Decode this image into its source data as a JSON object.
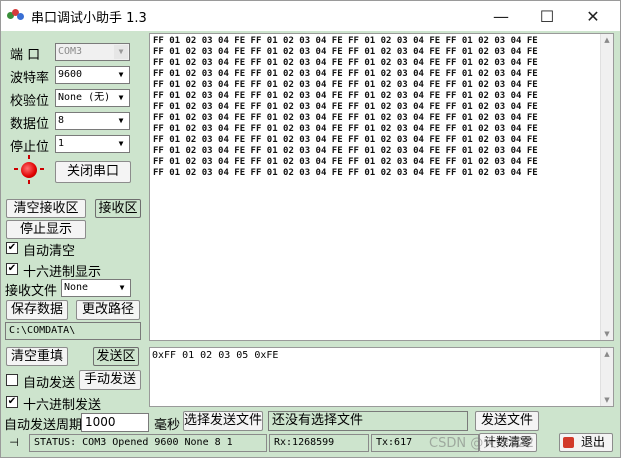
{
  "window": {
    "title": "串口调试小助手 1.3",
    "controls": {
      "minimize": "—",
      "maximize": "☐",
      "close": "✕"
    }
  },
  "port_settings": {
    "port_label": "端 口",
    "port_value": "COM3",
    "baud_label": "波特率",
    "baud_value": "9600",
    "parity_label": "校验位",
    "parity_value": "None (无)",
    "databits_label": "数据位",
    "databits_value": "8",
    "stopbits_label": "停止位",
    "stopbits_value": "1",
    "close_port_button": "关闭串口",
    "indicator_color": "#e00000"
  },
  "receive_panel": {
    "clear_button": "清空接收区",
    "area_label": "接收区",
    "stop_display_button": "停止显示",
    "auto_clear_label": "自动清空",
    "auto_clear_checked": true,
    "hex_display_label": "十六进制显示",
    "hex_display_checked": true,
    "recv_file_label": "接收文件",
    "recv_file_value": "None",
    "save_data_button": "保存数据",
    "change_path_button": "更改路径",
    "path_value": "C:\\COMDATA\\"
  },
  "receive_area": {
    "lines": [
      "FF 01 02 03 04 FE FF 01 02 03 04 FE FF 01 02 03 04 FE FF 01 02 03 04 FE",
      "FF 01 02 03 04 FE FF 01 02 03 04 FE FF 01 02 03 04 FE FF 01 02 03 04 FE",
      "FF 01 02 03 04 FE FF 01 02 03 04 FE FF 01 02 03 04 FE FF 01 02 03 04 FE",
      "FF 01 02 03 04 FE FF 01 02 03 04 FE FF 01 02 03 04 FE FF 01 02 03 04 FE",
      "FF 01 02 03 04 FE FF 01 02 03 04 FE FF 01 02 03 04 FE FF 01 02 03 04 FE",
      "FF 01 02 03 04 FE FF 01 02 03 04 FE FF 01 02 03 04 FE FF 01 02 03 04 FE",
      "FF 01 02 03 04 FE FF 01 02 03 04 FE FF 01 02 03 04 FE FF 01 02 03 04 FE",
      "FF 01 02 03 04 FE FF 01 02 03 04 FE FF 01 02 03 04 FE FF 01 02 03 04 FE",
      "FF 01 02 03 04 FE FF 01 02 03 04 FE FF 01 02 03 04 FE FF 01 02 03 04 FE",
      "FF 01 02 03 04 FE FF 01 02 03 04 FE FF 01 02 03 04 FE FF 01 02 03 04 FE",
      "FF 01 02 03 04 FE FF 01 02 03 04 FE FF 01 02 03 04 FE FF 01 02 03 04 FE",
      "FF 01 02 03 04 FE FF 01 02 03 04 FE FF 01 02 03 04 FE FF 01 02 03 04 FE",
      "FF 01 02 03 04 FE FF 01 02 03 04 FE FF 01 02 03 04 FE FF 01 02 03 04 FE"
    ]
  },
  "send_panel": {
    "clear_button": "清空重填",
    "area_label": "发送区",
    "auto_send_label": "自动发送",
    "auto_send_checked": false,
    "manual_send_button": "手动发送",
    "hex_send_label": "十六进制发送",
    "hex_send_checked": true,
    "period_label": "自动发送周期",
    "period_value": "1000",
    "period_unit": "毫秒",
    "select_file_button": "选择发送文件",
    "file_status": "还没有选择文件",
    "send_file_button": "发送文件",
    "send_text": "0xFF 01 02 03   05 0xFE"
  },
  "status_bar": {
    "status_text": "STATUS: COM3 Opened 9600 None  8 1",
    "rx_text": "Rx:1268599",
    "tx_text": "Tx:617",
    "reset_count_button": "计数清零",
    "exit_button": "退出",
    "watermark": "CSDN @天津822"
  }
}
